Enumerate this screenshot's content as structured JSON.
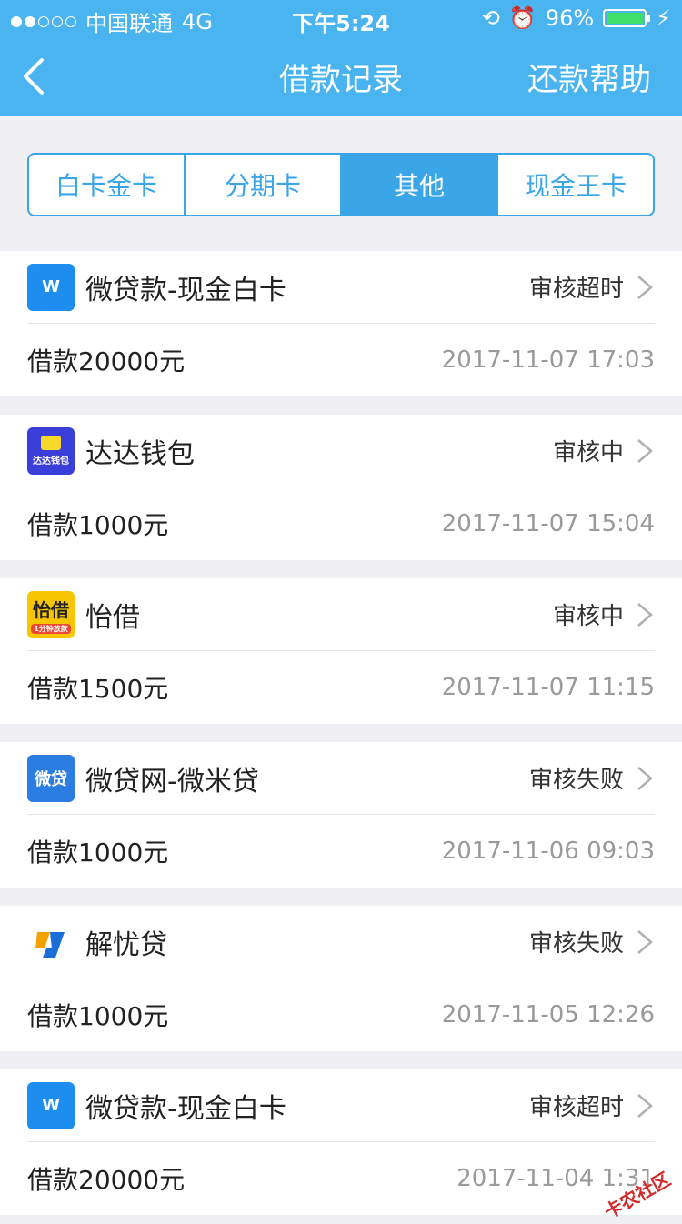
{
  "status_bar": {
    "carrier": "中国联通",
    "network": "4G",
    "time": "下午5:24",
    "battery": "96%",
    "battery_level": 0.96
  },
  "nav": {
    "title": "借款记录",
    "help": "还款帮助"
  },
  "tabs": [
    {
      "label": "白卡金卡",
      "active": false
    },
    {
      "label": "分期卡",
      "active": false
    },
    {
      "label": "其他",
      "active": true
    },
    {
      "label": "现金王卡",
      "active": false
    }
  ],
  "records": [
    {
      "name": "微贷款-现金白卡",
      "status": "审核超时",
      "amount": "借款20000元",
      "time": "2017-11-07 17:03",
      "logo": "W",
      "logo_color": "#1d8ef0"
    },
    {
      "name": "达达钱包",
      "status": "审核中",
      "amount": "借款1000元",
      "time": "2017-11-07 15:04",
      "logo": "达达钱包",
      "logo_color": "#3b3fd9"
    },
    {
      "name": "怡借",
      "status": "审核中",
      "amount": "借款1500元",
      "time": "2017-11-07 11:15",
      "logo": "怡借",
      "logo_color": "#f7c600"
    },
    {
      "name": "微贷网-微米贷",
      "status": "审核失败",
      "amount": "借款1000元",
      "time": "2017-11-06 09:03",
      "logo": "微贷",
      "logo_color": "#2c7de2"
    },
    {
      "name": "解忧贷",
      "status": "审核失败",
      "amount": "借款1000元",
      "time": "2017-11-05 12:26",
      "logo": "Y",
      "logo_color": "#ffffff"
    },
    {
      "name": "微贷款-现金白卡",
      "status": "审核超时",
      "amount": "借款20000元",
      "time": "2017-11-04 1:31",
      "logo": "W",
      "logo_color": "#1d8ef0"
    }
  ],
  "watermark": "卡农社区"
}
